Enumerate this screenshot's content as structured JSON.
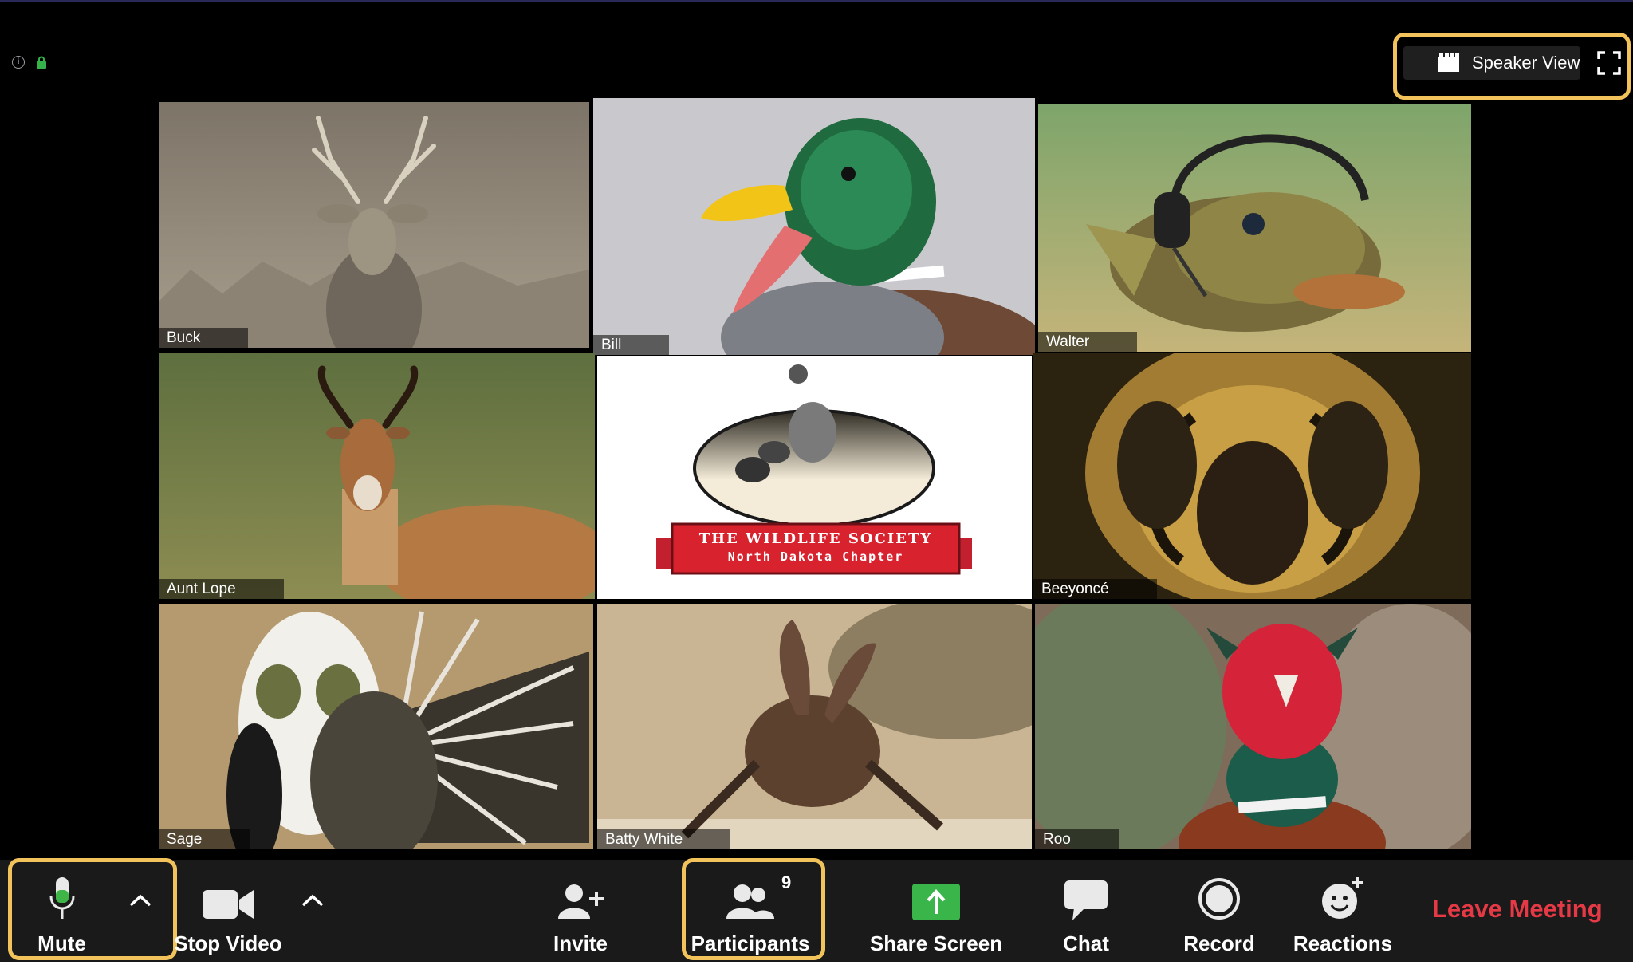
{
  "top": {
    "speaker_view_label": "Speaker View"
  },
  "participants": [
    {
      "name": "Buck",
      "active": false
    },
    {
      "name": "Bill",
      "active": true
    },
    {
      "name": "Walter",
      "active": false
    },
    {
      "name": "Aunt Lope",
      "active": false
    },
    {
      "name": "",
      "active": false
    },
    {
      "name": "Beeyoncé",
      "active": false
    },
    {
      "name": "Sage",
      "active": false
    },
    {
      "name": "Batty White",
      "active": false
    },
    {
      "name": "Roo",
      "active": false
    }
  ],
  "logo": {
    "org_line1": "THE WILDLIFE SOCIETY",
    "org_line2": "North Dakota Chapter"
  },
  "toolbar": {
    "mute_label": "Mute",
    "video_label": "Stop Video",
    "invite_label": "Invite",
    "participants_label": "Participants",
    "participants_count": "9",
    "share_label": "Share Screen",
    "chat_label": "Chat",
    "record_label": "Record",
    "reactions_label": "Reactions",
    "leave_label": "Leave Meeting"
  },
  "colors": {
    "active_speaker": "#8bc63e",
    "highlight": "#f2c35b",
    "share_green": "#3ab54a",
    "leave_red": "#e53946"
  }
}
